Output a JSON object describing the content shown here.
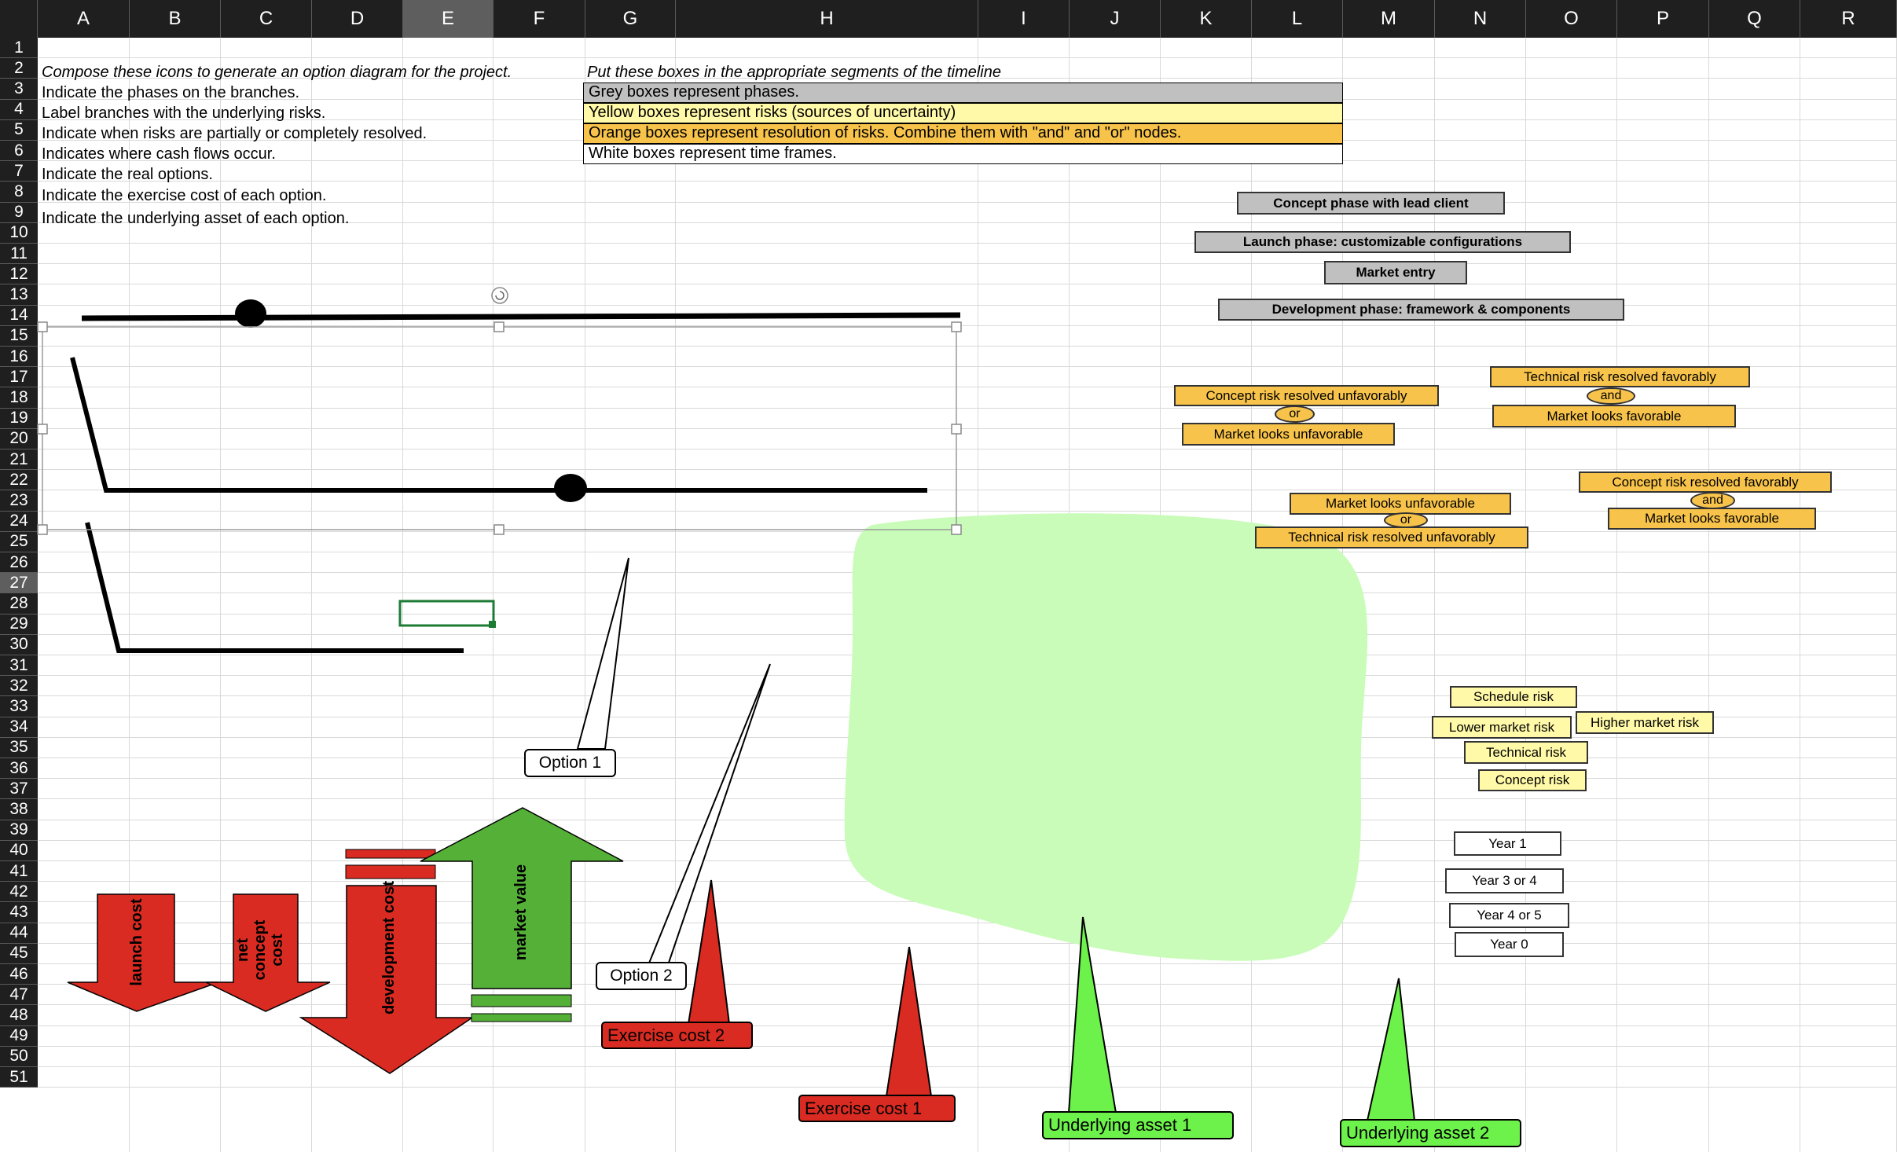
{
  "columns": [
    "A",
    "B",
    "C",
    "D",
    "E",
    "F",
    "G",
    "H",
    "I",
    "J",
    "K",
    "L",
    "M",
    "N",
    "O",
    "P",
    "Q",
    "R"
  ],
  "selected_column": "E",
  "rows": [
    "1",
    "2",
    "3",
    "4",
    "5",
    "6",
    "7",
    "8",
    "9",
    "10",
    "11",
    "12",
    "13",
    "14",
    "15",
    "16",
    "17",
    "18",
    "19",
    "20",
    "21",
    "22",
    "23",
    "24",
    "25",
    "26",
    "27",
    "28",
    "29",
    "30",
    "31",
    "32",
    "33",
    "34",
    "35",
    "36",
    "37",
    "38",
    "39",
    "40",
    "41",
    "42",
    "43",
    "44",
    "45",
    "46",
    "47",
    "48",
    "49",
    "50",
    "51"
  ],
  "selected_row": "27",
  "instructions": {
    "heading": "Compose these icons to generate an option diagram for the project.",
    "lines": [
      "Indicate the phases on the branches.",
      "Label branches with the underlying risks.",
      "Indicate when risks are partially or completely resolved.",
      "Indicates where cash flows occur.",
      "Indicate the real options.",
      "Indicate the exercise cost of each option.",
      "Indicate the underlying asset of each option."
    ]
  },
  "legend": {
    "heading": "Put these boxes in the appropriate segments of the timeline",
    "grey": "Grey boxes represent phases.",
    "yellow": "Yellow boxes represent risks (sources of uncertainty)",
    "orange": "Orange boxes represent resolution of risks. Combine them with \"and\" and \"or\" nodes.",
    "white": "White boxes represent time frames."
  },
  "phases": {
    "concept": "Concept phase with lead client",
    "launch": "Launch phase: customizable configurations",
    "market_entry": "Market entry",
    "development": "Development phase: framework & components"
  },
  "resolutions": {
    "group1_top": "Concept risk resolved unfavorably",
    "group1_node": "or",
    "group1_bottom": "Market looks unfavorable",
    "group2_top": "Technical risk resolved favorably",
    "group2_node": "and",
    "group2_bottom": "Market looks favorable",
    "group3_top": "Concept risk resolved favorably",
    "group3_node": "and",
    "group3_bottom": "Market looks favorable",
    "group4_top": "Market looks unfavorable",
    "group4_node": "or",
    "group4_bottom": "Technical risk resolved unfavorably"
  },
  "risks": {
    "schedule": "Schedule risk",
    "lower_market": "Lower market risk",
    "higher_market": "Higher market risk",
    "technical": "Technical risk",
    "concept": "Concept risk"
  },
  "time_frames": {
    "year1": "Year 1",
    "year3or4": "Year 3 or 4",
    "year4or5": "Year 4 or 5",
    "year0": "Year 0"
  },
  "callouts": {
    "option1": "Option 1",
    "option2": "Option 2"
  },
  "cash_flows": {
    "launch_cost": "launch cost",
    "net_concept_cost": "net concept cost",
    "development_cost": "development cost",
    "market_value": "market value"
  },
  "exercise_costs": {
    "cost1": "Exercise cost 1",
    "cost2": "Exercise cost 2"
  },
  "underlying_assets": {
    "asset1": "Underlying asset 1",
    "asset2": "Underlying asset 2"
  },
  "colors": {
    "header_bg": "#1f1f1f",
    "header_selected": "#5e5e5e",
    "grid": "#d9d9d9",
    "phase_grey": "#c0c0c0",
    "risk_yellow": "#fff9a8",
    "resolution_orange": "#f7c34a",
    "cost_red": "#d92b22",
    "value_green": "#55b038",
    "asset_green": "#6cf24a",
    "blob_green": "#c8fcb8",
    "active_cell": "#1e7b34"
  }
}
